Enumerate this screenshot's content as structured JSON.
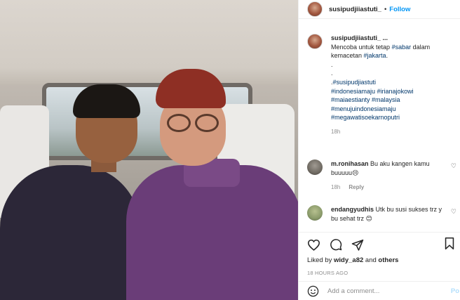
{
  "header": {
    "username": "susipudjiiastuti_",
    "separator": "•",
    "follow_label": "Follow"
  },
  "caption": {
    "username": "susipudjiiastuti_ ...",
    "text": "Mencoba untuk tetap ",
    "tag1": "#sabar",
    "text2": " dalam kemacetan ",
    "tag2": "#jakarta",
    "text3": ".",
    "dot1": ".",
    "dot2": ".",
    "dot3": ".",
    "hashtags": [
      "#susipudjiastuti",
      "#indonesiamaju #irianajokowi",
      "#maiaestianty #malaysia",
      "#menujuindonesiamaju",
      "#megawatisoekarnoputri"
    ],
    "time": "18h"
  },
  "comments": [
    {
      "username": "m.ronihasan",
      "text": " Bu aku kangen kamu buuuuu😢",
      "time": "18h",
      "reply_label": "Reply",
      "avatar_color": "#6f6a62"
    },
    {
      "username": "endangyudhis",
      "text": " Utk bu susi sukses trz y bu sehat trz 😊",
      "avatar_color": "#8a9a6a"
    }
  ],
  "actions": {
    "icons": [
      "heart-icon",
      "comment-icon",
      "share-icon",
      "bookmark-icon"
    ],
    "likes_prefix": "Liked by ",
    "likes_user": "widy_a82",
    "likes_mid": " and ",
    "likes_others": "others",
    "timestamp": "18 HOURS AGO"
  },
  "add_comment": {
    "placeholder": "Add a comment...",
    "post_label": "Po"
  }
}
